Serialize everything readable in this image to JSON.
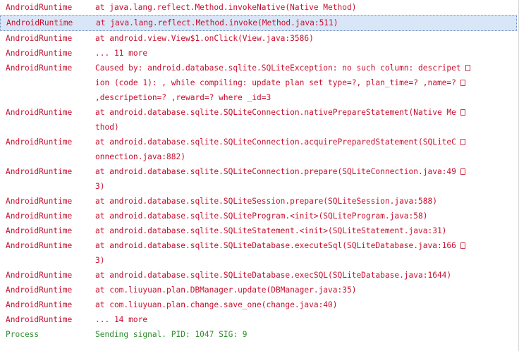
{
  "colors": {
    "error": "#c8102e",
    "info": "#2f8f2f",
    "selection": "#d9e6f7"
  },
  "rows": [
    {
      "tag": "AndroidRuntime",
      "lines": [
        "at java.lang.reflect.Method.invokeNative(Native Method)"
      ],
      "level": "error",
      "selected": false
    },
    {
      "tag": "AndroidRuntime",
      "lines": [
        "at java.lang.reflect.Method.invoke(Method.java:511)"
      ],
      "level": "error",
      "selected": true
    },
    {
      "tag": "AndroidRuntime",
      "lines": [
        "at android.view.View$1.onClick(View.java:3586)"
      ],
      "level": "error",
      "selected": false
    },
    {
      "tag": "AndroidRuntime",
      "lines": [
        "... 11 more"
      ],
      "level": "error",
      "selected": false
    },
    {
      "tag": "AndroidRuntime",
      "lines": [
        "Caused by: android.database.sqlite.SQLiteException: no such column: descripet",
        "ion (code 1): , while compiling: update plan set type=?, plan_time=? ,name=?",
        ",descripetion=? ,reward=? where _id=3"
      ],
      "level": "error",
      "selected": false
    },
    {
      "tag": "AndroidRuntime",
      "lines": [
        "at android.database.sqlite.SQLiteConnection.nativePrepareStatement(Native Me",
        "thod)"
      ],
      "level": "error",
      "selected": false
    },
    {
      "tag": "AndroidRuntime",
      "lines": [
        "at android.database.sqlite.SQLiteConnection.acquirePreparedStatement(SQLiteC",
        "onnection.java:882)"
      ],
      "level": "error",
      "selected": false
    },
    {
      "tag": "AndroidRuntime",
      "lines": [
        "at android.database.sqlite.SQLiteConnection.prepare(SQLiteConnection.java:49",
        "3)"
      ],
      "level": "error",
      "selected": false
    },
    {
      "tag": "AndroidRuntime",
      "lines": [
        "at android.database.sqlite.SQLiteSession.prepare(SQLiteSession.java:588)"
      ],
      "level": "error",
      "selected": false
    },
    {
      "tag": "AndroidRuntime",
      "lines": [
        "at android.database.sqlite.SQLiteProgram.<init>(SQLiteProgram.java:58)"
      ],
      "level": "error",
      "selected": false
    },
    {
      "tag": "AndroidRuntime",
      "lines": [
        "at android.database.sqlite.SQLiteStatement.<init>(SQLiteStatement.java:31)"
      ],
      "level": "error",
      "selected": false
    },
    {
      "tag": "AndroidRuntime",
      "lines": [
        "at android.database.sqlite.SQLiteDatabase.executeSql(SQLiteDatabase.java:166",
        "3)"
      ],
      "level": "error",
      "selected": false
    },
    {
      "tag": "AndroidRuntime",
      "lines": [
        "at android.database.sqlite.SQLiteDatabase.execSQL(SQLiteDatabase.java:1644)"
      ],
      "level": "error",
      "selected": false
    },
    {
      "tag": "AndroidRuntime",
      "lines": [
        "at com.liuyuan.plan.DBManager.update(DBManager.java:35)"
      ],
      "level": "error",
      "selected": false
    },
    {
      "tag": "AndroidRuntime",
      "lines": [
        "at com.liuyuan.plan.change.save_one(change.java:40)"
      ],
      "level": "error",
      "selected": false
    },
    {
      "tag": "AndroidRuntime",
      "lines": [
        "... 14 more"
      ],
      "level": "error",
      "selected": false
    },
    {
      "tag": "Process",
      "lines": [
        "Sending signal. PID: 1047 SIG: 9"
      ],
      "level": "info",
      "selected": false
    }
  ]
}
